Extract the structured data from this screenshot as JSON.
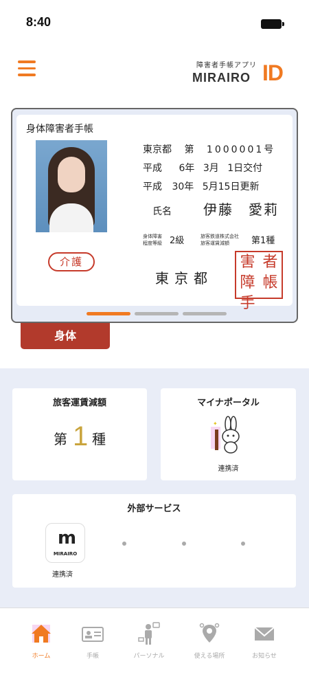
{
  "status": {
    "time": "8:40"
  },
  "header": {
    "logo_sub": "障害者手帳アプリ",
    "logo_main": "MIRAIRO",
    "logo_id": "ID"
  },
  "card": {
    "title": "身体障害者手帳",
    "stamp": "介護",
    "prefecture": "東京都",
    "number_label": "第",
    "number": "1000001号",
    "issue_era": "平成",
    "issue_year": "6年",
    "issue_month": "3月",
    "issue_day": "1日交付",
    "renew_era": "平成",
    "renew_year": "30年",
    "renew_month": "5月15日更新",
    "name_label": "氏名",
    "name": "伊藤　愛莉",
    "disability_label_1": "身体障害",
    "disability_label_2": "程度等級",
    "grade": "2級",
    "rail_label_1": "旅客鉄道株式会社",
    "rail_label_2": "旅客運賃減額",
    "rail_class": "第1種",
    "issuer": "東京都",
    "seal_chars": [
      "害",
      "者",
      "障",
      "帳",
      "手",
      ""
    ]
  },
  "type_tab": "身体",
  "fare_panel": {
    "title": "旅客運賃減額",
    "prefix": "第",
    "number": "1",
    "suffix": "種"
  },
  "mynumber_panel": {
    "title": "マイナポータル",
    "status": "連携済"
  },
  "services_panel": {
    "title": "外部サービス",
    "service_name": "MIRAIRO",
    "status": "連携済"
  },
  "nav": [
    {
      "label": "ホーム",
      "icon": "home-icon"
    },
    {
      "label": "手帳",
      "icon": "id-card-icon"
    },
    {
      "label": "パーソナル",
      "icon": "person-icon"
    },
    {
      "label": "使える場所",
      "icon": "location-pin-icon"
    },
    {
      "label": "お知らせ",
      "icon": "mail-icon"
    }
  ],
  "colors": {
    "accent": "#f07a22",
    "tab_red": "#b23a2c",
    "seal_red": "#c63a2a",
    "gold": "#c9a43d"
  }
}
